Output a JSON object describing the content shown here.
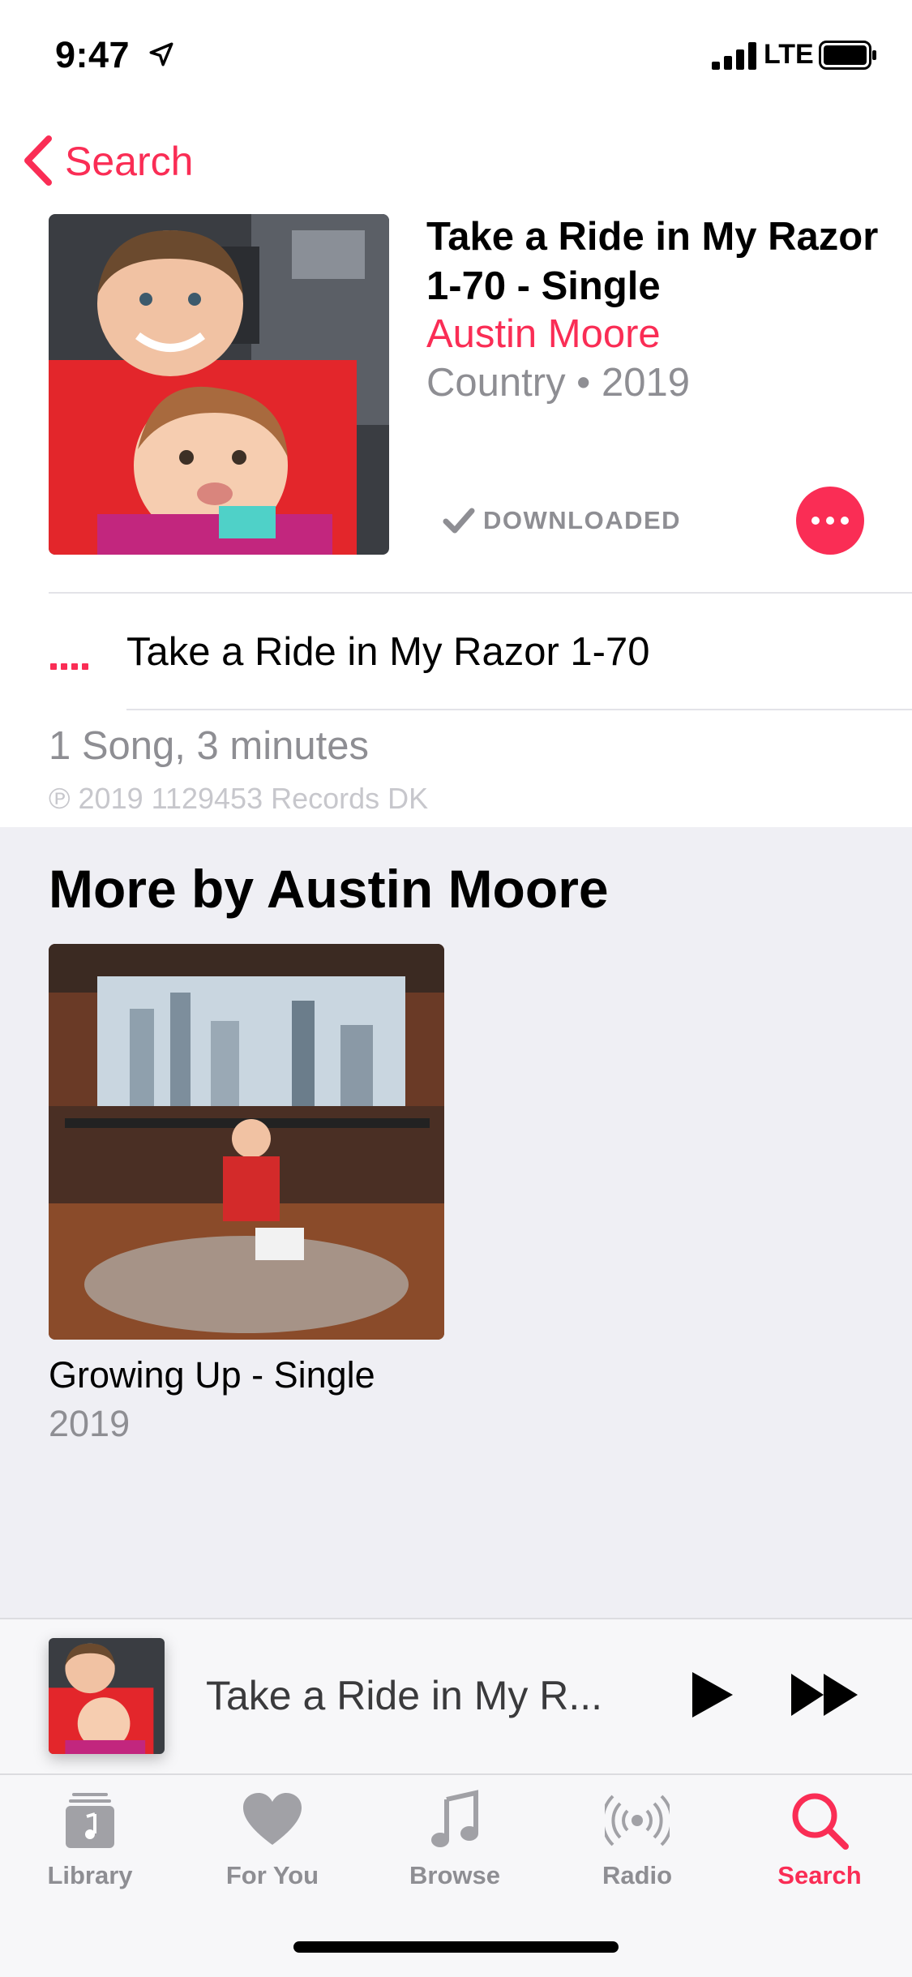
{
  "status_bar": {
    "time": "9:47",
    "network": "LTE"
  },
  "nav": {
    "back_label": "Search"
  },
  "album": {
    "title": "Take a Ride in My Razor 1-70 - Single",
    "artist": "Austin Moore",
    "meta": "Country • 2019",
    "downloaded_label": "DOWNLOADED"
  },
  "tracks": [
    {
      "title": "Take a Ride in My Razor 1-70"
    }
  ],
  "footer": {
    "count": "1 Song, 3 minutes",
    "copyright": "℗ 2019 1129453 Records DK"
  },
  "more_by": {
    "heading": "More by Austin Moore",
    "albums": [
      {
        "title": "Growing Up - Single",
        "year": "2019"
      }
    ]
  },
  "now_playing": {
    "title": "Take a Ride in My R..."
  },
  "tab_bar": {
    "tabs": [
      {
        "label": "Library",
        "icon": "library-icon"
      },
      {
        "label": "For You",
        "icon": "heart-icon"
      },
      {
        "label": "Browse",
        "icon": "music-note-icon"
      },
      {
        "label": "Radio",
        "icon": "radio-icon"
      },
      {
        "label": "Search",
        "icon": "search-icon",
        "active": true
      }
    ]
  },
  "colors": {
    "accent": "#fa2d55",
    "secondary_text": "#8e8e93",
    "section_background": "#efeff4"
  }
}
